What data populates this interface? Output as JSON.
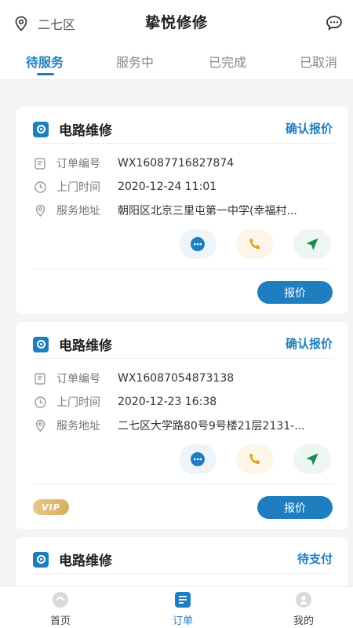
{
  "header": {
    "location": "二七区",
    "app_title": "挚悦修修",
    "location_icon": "location-pin-icon",
    "message_icon": "message-bubble-icon"
  },
  "tabs": [
    {
      "label": "待服务",
      "active": true
    },
    {
      "label": "服务中",
      "active": false
    },
    {
      "label": "已完成",
      "active": false
    },
    {
      "label": "已取消",
      "active": false
    }
  ],
  "orders": [
    {
      "service": "电路维修",
      "status": "确认报价",
      "order_no_label": "订单编号",
      "order_no": "WX16087716827874",
      "time_label": "上门时间",
      "time": "2020-12-24 11:01",
      "address_label": "服务地址",
      "address": "朝阳区北京三里屯第一中学(幸福村...",
      "vip": false,
      "button": "报价"
    },
    {
      "service": "电路维修",
      "status": "确认报价",
      "order_no_label": "订单编号",
      "order_no": "WX16087054873138",
      "time_label": "上门时间",
      "time": "2020-12-23 16:38",
      "address_label": "服务地址",
      "address": "二七区大学路80号9号楼21层2131-...",
      "vip": true,
      "vip_label": "VIP",
      "button": "报价"
    },
    {
      "service": "电路维修",
      "status": "待支付"
    }
  ],
  "bottom_nav": [
    {
      "label": "首页",
      "icon": "home-icon",
      "active": false
    },
    {
      "label": "订单",
      "icon": "order-list-icon",
      "active": true
    },
    {
      "label": "我的",
      "icon": "profile-icon",
      "active": false
    }
  ],
  "colors": {
    "accent": "#1f7ebf",
    "phone": "#e0a21a",
    "navigate": "#1e8a4c",
    "background": "#f3f4f6"
  }
}
